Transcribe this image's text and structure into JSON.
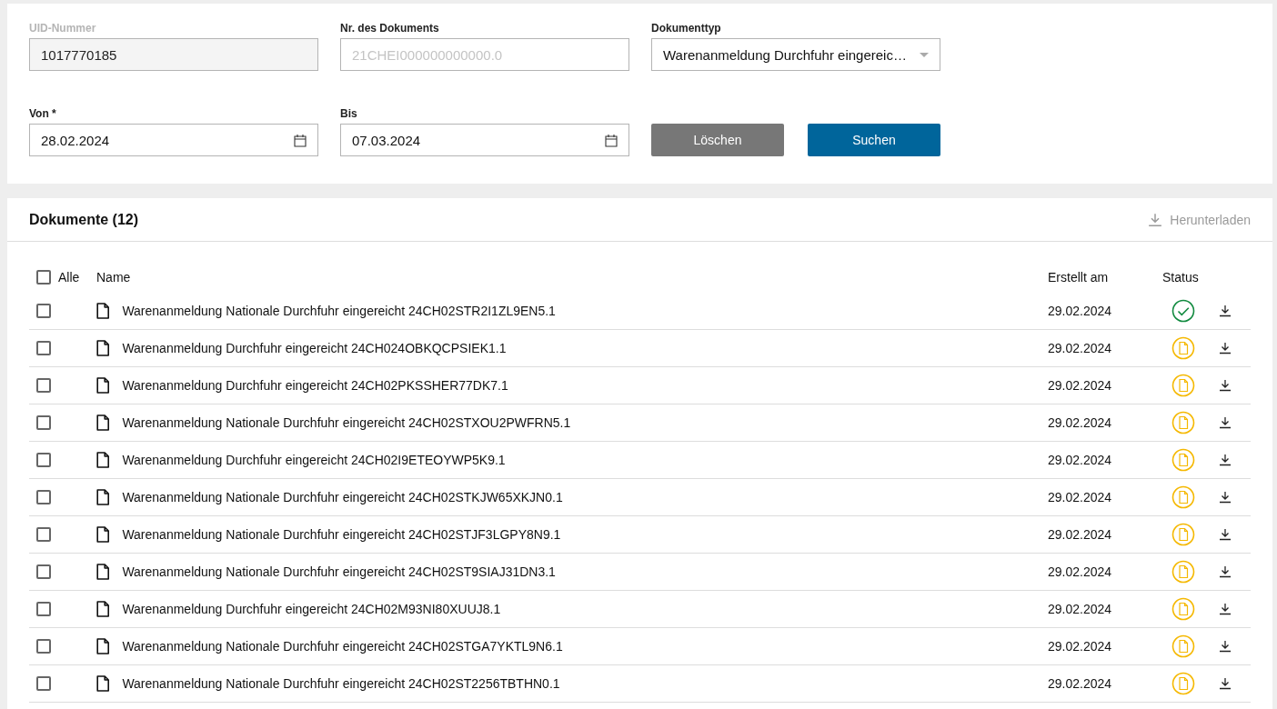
{
  "filters": {
    "uid": {
      "label": "UID-Nummer",
      "value": "1017770185",
      "disabled": true
    },
    "document_number": {
      "label": "Nr. des Dokuments",
      "placeholder": "21CHEI000000000000.0"
    },
    "document_type": {
      "label": "Dokumenttyp",
      "value": "Warenanmeldung Durchfuhr eingereic…"
    },
    "from": {
      "label": "Von *",
      "value": "28.02.2024"
    },
    "to": {
      "label": "Bis",
      "value": "07.03.2024"
    },
    "buttons": [
      {
        "label": "Löschen",
        "kind": "secondary"
      },
      {
        "label": "Suchen",
        "kind": "primary"
      }
    ]
  },
  "documents": {
    "title": "Dokumente (12)",
    "download": {
      "label": "Herunterladen",
      "disabled": true
    },
    "select_all": {
      "label": "Alle",
      "checked": false
    },
    "columns": [
      "Name",
      "Erstellt am",
      "Status"
    ],
    "rows": [
      {
        "name": "Warenanmeldung Nationale Durchfuhr eingereicht 24CH02STR2I1ZL9EN5.1",
        "created": "29.02.2024",
        "kind": "accepted",
        "checked": false
      },
      {
        "name": "Warenanmeldung Durchfuhr eingereicht 24CH024OBKQCPSIEK1.1",
        "created": "29.02.2024",
        "kind": "submitted",
        "checked": false
      },
      {
        "name": "Warenanmeldung Durchfuhr eingereicht 24CH02PKSSHER77DK7.1",
        "created": "29.02.2024",
        "kind": "submitted",
        "checked": false
      },
      {
        "name": "Warenanmeldung Nationale Durchfuhr eingereicht 24CH02STXOU2PWFRN5.1",
        "created": "29.02.2024",
        "kind": "submitted",
        "checked": false
      },
      {
        "name": "Warenanmeldung Durchfuhr eingereicht 24CH02I9ETEOYWP5K9.1",
        "created": "29.02.2024",
        "kind": "submitted",
        "checked": false
      },
      {
        "name": "Warenanmeldung Nationale Durchfuhr eingereicht 24CH02STKJW65XKJN0.1",
        "created": "29.02.2024",
        "kind": "submitted",
        "checked": false
      },
      {
        "name": "Warenanmeldung Nationale Durchfuhr eingereicht 24CH02STJF3LGPY8N9.1",
        "created": "29.02.2024",
        "kind": "submitted",
        "checked": false
      },
      {
        "name": "Warenanmeldung Nationale Durchfuhr eingereicht 24CH02ST9SIAJ31DN3.1",
        "created": "29.02.2024",
        "kind": "submitted",
        "checked": false
      },
      {
        "name": "Warenanmeldung Durchfuhr eingereicht 24CH02M93NI80XUUJ8.1",
        "created": "29.02.2024",
        "kind": "submitted",
        "checked": false
      },
      {
        "name": "Warenanmeldung Nationale Durchfuhr eingereicht 24CH02STGA7YKTL9N6.1",
        "created": "29.02.2024",
        "kind": "submitted",
        "checked": false
      },
      {
        "name": "Warenanmeldung Nationale Durchfuhr eingereicht 24CH02ST2256TBTHN0.1",
        "created": "29.02.2024",
        "kind": "submitted",
        "checked": false
      }
    ]
  }
}
